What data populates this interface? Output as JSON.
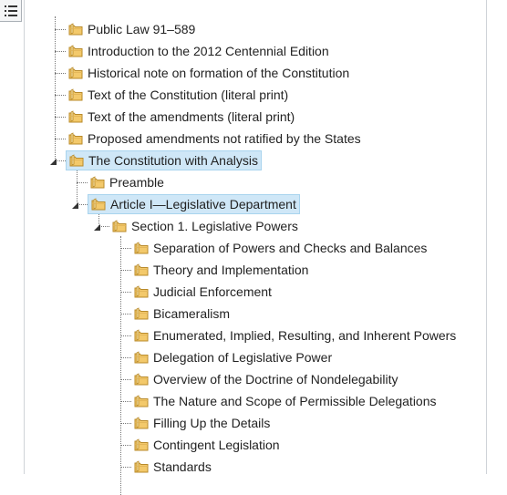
{
  "toolbar": {
    "toggle_icon": "list-icon"
  },
  "colors": {
    "selected_bg": "#cfe7f7",
    "folder_fill": "#f3c96b",
    "folder_stroke": "#b88a2a"
  },
  "tree": {
    "root_items": [
      "Public Law 91–589",
      "Introduction to the 2012 Centennial Edition",
      "Historical note on formation of the Constitution",
      "Text of the Constitution (literal print)",
      "Text of the amendments (literal print)",
      "Proposed amendments not ratified by the States",
      "The Constitution with Analysis"
    ],
    "analysis_children": [
      "Preamble",
      "Article I—Legislative Department"
    ],
    "article_children": [
      "Section 1. Legislative Powers"
    ],
    "section_children": [
      "Separation of Powers and Checks and Balances",
      "Theory and Implementation",
      "Judicial Enforcement",
      "Bicameralism",
      "Enumerated, Implied, Resulting, and Inherent Powers",
      "Delegation of Legislative Power",
      "Overview of the Doctrine of Nondelegability",
      "The Nature and Scope of Permissible Delegations",
      "Filling Up the Details",
      "Contingent Legislation",
      "Standards"
    ]
  }
}
